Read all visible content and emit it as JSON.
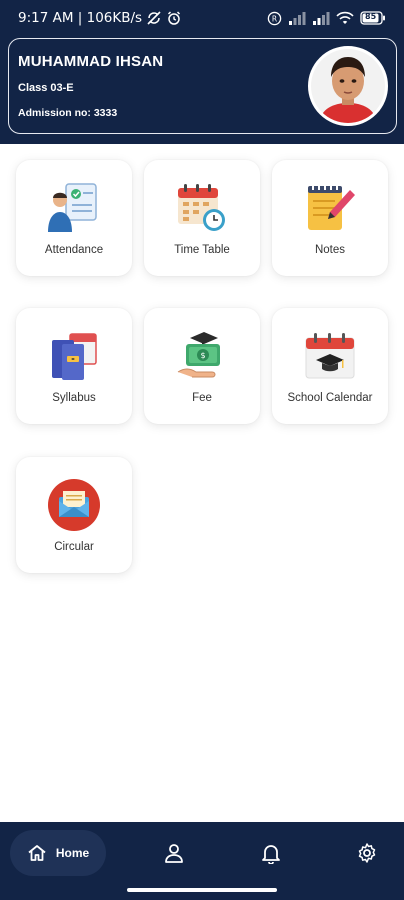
{
  "status_bar": {
    "time_speed": "9:17 AM | 106KB/s",
    "battery": "85"
  },
  "profile": {
    "name": "MUHAMMAD IHSAN",
    "class": "Class 03-E",
    "admission": "Admission no: 3333"
  },
  "tiles": [
    {
      "label": "Attendance",
      "icon": "attendance-icon"
    },
    {
      "label": "Time Table",
      "icon": "calendar-clock-icon"
    },
    {
      "label": "Notes",
      "icon": "notepad-icon"
    },
    {
      "label": "Syllabus",
      "icon": "books-icon"
    },
    {
      "label": "Fee",
      "icon": "money-hand-icon"
    },
    {
      "label": "School Calendar",
      "icon": "graduation-calendar-icon"
    },
    {
      "label": "Circular",
      "icon": "envelope-icon"
    }
  ],
  "nav": {
    "home_label": "Home"
  },
  "colors": {
    "navy": "#122446",
    "home_pill": "#1f3257"
  }
}
